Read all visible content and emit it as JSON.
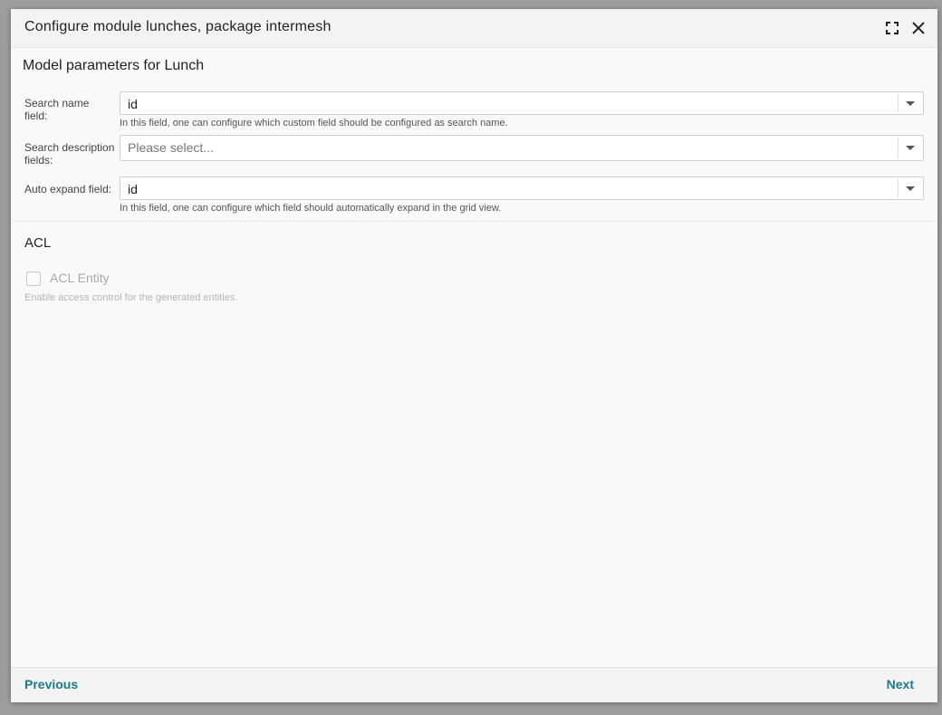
{
  "dialog": {
    "title": "Configure module lunches, package intermesh",
    "icons": {
      "maximize": "maximize-icon",
      "close": "close-icon"
    }
  },
  "model_section": {
    "title": "Model parameters for Lunch",
    "fields": [
      {
        "label": "Search name field:",
        "value": "id",
        "hint": "In this field, one can configure which custom field should be configured as search name."
      },
      {
        "label": "Search description fields:",
        "placeholder": "Please select..."
      },
      {
        "label": "Auto expand field:",
        "value": "id",
        "hint": "In this field, one can configure which field should automatically expand in the grid view."
      }
    ]
  },
  "acl_section": {
    "title": "ACL",
    "checkbox_label": "ACL Entity",
    "checkbox_checked": false,
    "hint": "Enable access control for the generated entities."
  },
  "footer": {
    "previous_label": "Previous",
    "next_label": "Next"
  },
  "colors": {
    "accent": "#1c7a86",
    "backdrop": "#9d9d9d",
    "dialog_bg": "#f9f9f9"
  }
}
